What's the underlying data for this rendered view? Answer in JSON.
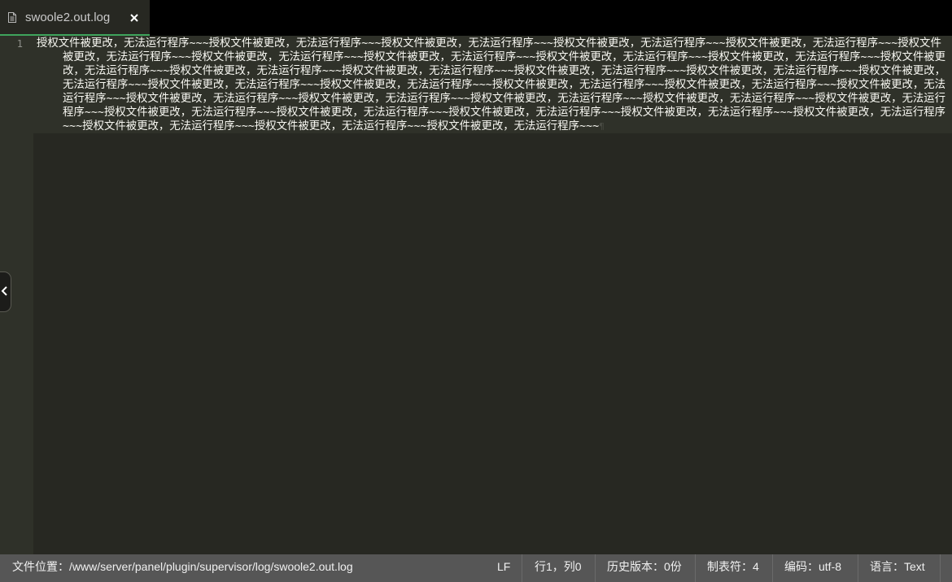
{
  "tab": {
    "filename": "swoole2.out.log",
    "file_icon": "document-icon",
    "close_icon": "close-icon"
  },
  "editor": {
    "line_numbers": [
      "1"
    ],
    "content": "授权文件被更改，无法运行程序~~~授权文件被更改，无法运行程序~~~授权文件被更改，无法运行程序~~~授权文件被更改，无法运行程序~~~授权文件被更改，无法运行程序~~~授权文件被更改，无法运行程序~~~授权文件被更改，无法运行程序~~~授权文件被更改，无法运行程序~~~授权文件被更改，无法运行程序~~~授权文件被更改，无法运行程序~~~授权文件被更改，无法运行程序~~~授权文件被更改，无法运行程序~~~授权文件被更改，无法运行程序~~~授权文件被更改，无法运行程序~~~授权文件被更改，无法运行程序~~~授权文件被更改，无法运行程序~~~授权文件被更改，无法运行程序~~~授权文件被更改，无法运行程序~~~授权文件被更改，无法运行程序~~~授权文件被更改，无法运行程序~~~授权文件被更改，无法运行程序~~~授权文件被更改，无法运行程序~~~授权文件被更改，无法运行程序~~~授权文件被更改，无法运行程序~~~授权文件被更改，无法运行程序~~~授权文件被更改，无法运行程序~~~授权文件被更改，无法运行程序~~~授权文件被更改，无法运行程序~~~授权文件被更改，无法运行程序~~~授权文件被更改，无法运行程序~~~授权文件被更改，无法运行程序~~~授权文件被更改，无法运行程序~~~授权文件被更改，无法运行程序~~~授权文件被更改，无法运行程序~~~",
    "eol_marker": "¶",
    "side_toggle_icon": "chevron-left-icon"
  },
  "statusbar": {
    "path": "文件位置：/www/server/panel/plugin/supervisor/log/swoole2.out.log",
    "line_ending": "LF",
    "cursor": "行1，列0",
    "history": "历史版本：0份",
    "tab_size": "制表符：4",
    "encoding": "编码：utf-8",
    "language": "语言：Text"
  },
  "colors": {
    "accent": "#3fa45c",
    "editor_bg": "#272822",
    "text": "#f8f8f2",
    "statusbar_bg": "#565656"
  }
}
